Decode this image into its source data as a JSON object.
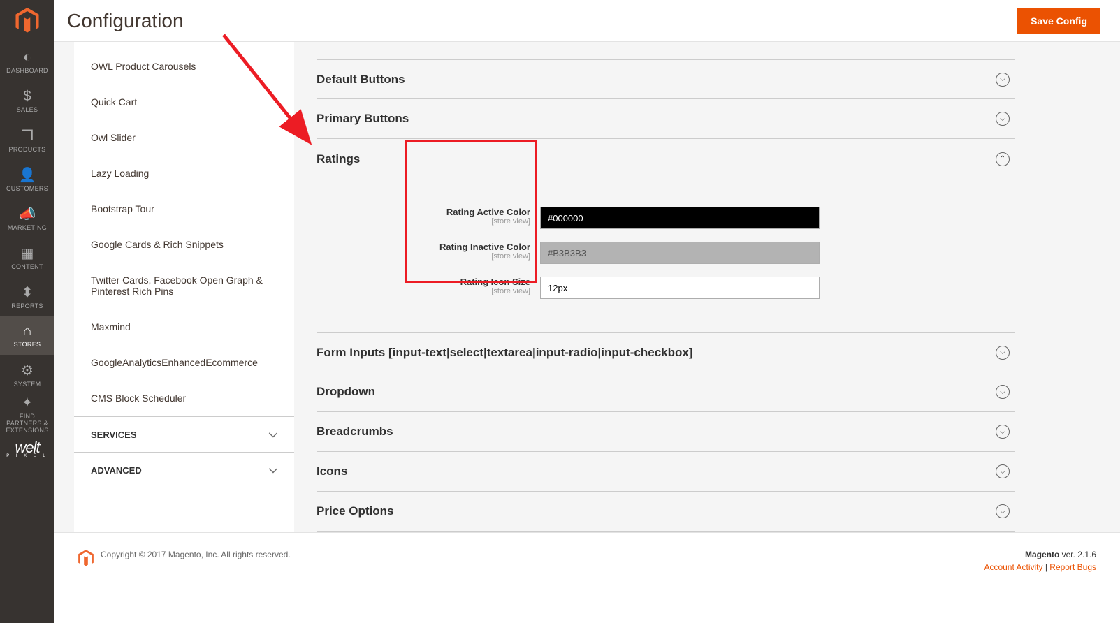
{
  "header": {
    "title": "Configuration",
    "save": "Save Config"
  },
  "mainNav": {
    "dashboard": "DASHBOARD",
    "sales": "SALES",
    "products": "PRODUCTS",
    "customers": "CUSTOMERS",
    "marketing": "MARKETING",
    "content": "CONTENT",
    "reports": "REPORTS",
    "stores": "STORES",
    "system": "SYSTEM",
    "find": "FIND PARTNERS & EXTENSIONS"
  },
  "sidebar": {
    "items": [
      "OWL Product Carousels",
      "Quick Cart",
      "Owl Slider",
      "Lazy Loading",
      "Bootstrap Tour",
      "Google Cards & Rich Snippets",
      "Twitter Cards, Facebook Open Graph & Pinterest Rich Pins",
      "Maxmind",
      "GoogleAnalyticsEnhancedEcommerce",
      "CMS Block Scheduler"
    ],
    "services": "SERVICES",
    "advanced": "ADVANCED"
  },
  "sections": {
    "default": "Default Buttons",
    "primary": "Primary Buttons",
    "ratings": "Ratings",
    "forms": "Form Inputs [input-text|select|textarea|input-radio|input-checkbox]",
    "dropdown": "Dropdown",
    "breadcrumbs": "Breadcrumbs",
    "icons": "Icons",
    "price": "Price Options"
  },
  "ratings": {
    "activeColor": {
      "label": "Rating Active Color",
      "scope": "[store view]",
      "value": "#000000"
    },
    "inactiveColor": {
      "label": "Rating Inactive Color",
      "scope": "[store view]",
      "value": "#B3B3B3"
    },
    "iconSize": {
      "label": "Rating Icon Size",
      "scope": "[store view]",
      "value": "12px"
    }
  },
  "footer": {
    "copy": "Copyright © 2017 Magento, Inc. All rights reserved.",
    "magento": "Magento",
    "ver": " ver. 2.1.6",
    "acct": "Account Activity",
    "sep": " | ",
    "bugs": "Report Bugs"
  }
}
